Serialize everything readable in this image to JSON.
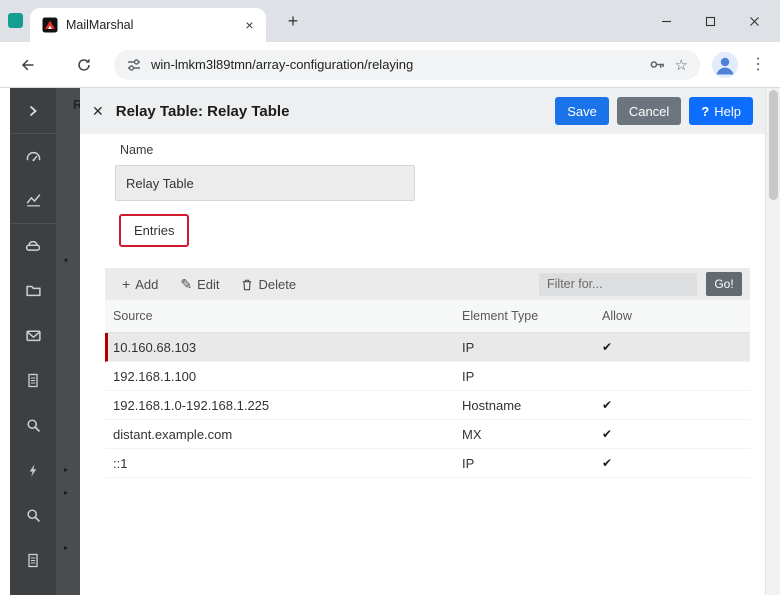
{
  "browser": {
    "tab_title": "MailMarshal",
    "tab_close_glyph": "×",
    "new_tab_glyph": "+",
    "url": "win-lmkm3l89tmn/array-configuration/relaying"
  },
  "sidebar": {
    "icons": [
      "expand-chevron",
      "dashboard-gauge",
      "line-chart",
      "server",
      "folder",
      "mail-envelope",
      "document",
      "search",
      "lightning",
      "search",
      "document"
    ]
  },
  "strip": {
    "clipped_label": "R",
    "expand_down_glyph": "▾",
    "expand_right_glyph": "▸"
  },
  "panel": {
    "close_glyph": "✕",
    "title": "Relay Table: Relay Table",
    "save_label": "Save",
    "cancel_label": "Cancel",
    "help_icon": "?",
    "help_label": "Help"
  },
  "form": {
    "name_label": "Name",
    "name_value": "Relay Table",
    "entries_label": "Entries"
  },
  "grid": {
    "toolbar": {
      "add_icon": "+",
      "add_label": "Add",
      "edit_icon": "✎",
      "edit_label": "Edit",
      "delete_label": "Delete",
      "filter_placeholder": "Filter for...",
      "go_label": "Go!"
    },
    "columns": [
      "Source",
      "Element Type",
      "Allow"
    ],
    "check_glyph": "✔",
    "rows": [
      {
        "source": "10.160.68.103",
        "element_type": "IP",
        "allow": true,
        "selected": true
      },
      {
        "source": "192.168.1.100",
        "element_type": "IP",
        "allow": false,
        "selected": false
      },
      {
        "source": "192.168.1.0-192.168.1.225",
        "element_type": "Hostname",
        "allow": true,
        "selected": false
      },
      {
        "source": "distant.example.com",
        "element_type": "MX",
        "allow": true,
        "selected": false
      },
      {
        "source": "::1",
        "element_type": "IP",
        "allow": true,
        "selected": false
      }
    ]
  },
  "colors": {
    "save_blue": "#1a73e8",
    "help_blue": "#0d6efd",
    "cancel_gray": "#6c757d",
    "selected_row_red": "#ad0000",
    "entries_border_red": "#d01b2f"
  }
}
